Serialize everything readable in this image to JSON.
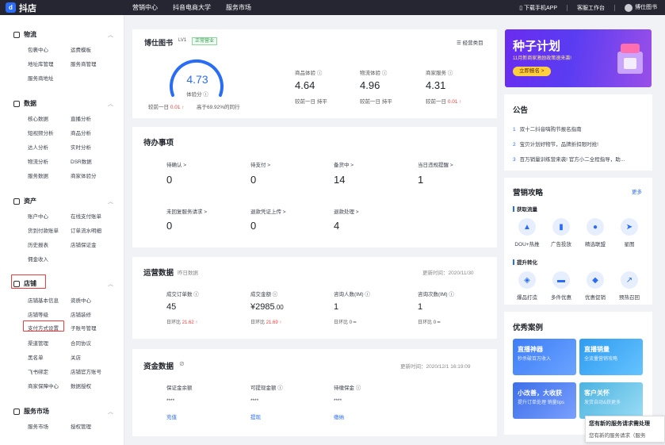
{
  "app": {
    "logo_mark": "d",
    "logo_text": "抖店"
  },
  "topnav": [
    "营销中心",
    "抖音电商大学",
    "服务市场"
  ],
  "topright": {
    "download": "下载手机APP",
    "workbench": "客服工作台",
    "user": "博仕图书"
  },
  "sidebar": {
    "groups": [
      {
        "title": "物流",
        "items": [
          "包裹中心",
          "运费模板",
          "地址库管理",
          "服务商管理",
          "服务商地址"
        ]
      },
      {
        "title": "数据",
        "items": [
          "核心数据",
          "直播分析",
          "短视频分析",
          "商品分析",
          "达人分析",
          "实时分析",
          "物流分析",
          "DSR数据",
          "服务数据",
          "商家体验分"
        ]
      },
      {
        "title": "资产",
        "items": [
          "账户中心",
          "在线支付账单",
          "货到付款账单",
          "订单流水明细",
          "历史报表",
          "店铺保证金",
          "佣金收入"
        ]
      },
      {
        "title": "店铺",
        "items": [
          "店铺基本信息",
          "资质中心",
          "店铺等级",
          "店铺装修",
          "支付方式设置",
          "子账号管理",
          "渠道管理",
          "合同协议",
          "黑名单",
          "关店",
          "飞书绑定",
          "店铺官方账号",
          "商家保障中心",
          "数据授权"
        ]
      },
      {
        "title": "服务市场",
        "items": [
          "服务市场",
          "授权管理"
        ]
      }
    ]
  },
  "shop": {
    "name": "博仕图书",
    "level": "LV1",
    "status": "正常营业",
    "category_link": "经营类目",
    "score": "4.73",
    "score_label": "体验分",
    "compare_prefix": "较前一日",
    "compare_value": "0.01",
    "compare_up": "↑",
    "rank_text": "高于69.92%的同行",
    "metrics": [
      {
        "label": "商品体验",
        "value": "4.64",
        "sub": "较前一日",
        "trend": "持平"
      },
      {
        "label": "物流体验",
        "value": "4.96",
        "sub": "较前一日",
        "trend": "持平"
      },
      {
        "label": "商家服务",
        "value": "4.31",
        "sub": "较前一日",
        "trend": "0.01 ↑"
      }
    ]
  },
  "todo": {
    "title": "待办事项",
    "items": [
      {
        "label": "待确认 >",
        "value": "0"
      },
      {
        "label": "待支付 >",
        "value": "0"
      },
      {
        "label": "备货中 >",
        "value": "14"
      },
      {
        "label": "当日违规提醒 >",
        "value": "1"
      },
      {
        "label": "未回复服务请求 >",
        "value": "0"
      },
      {
        "label": "退款凭证上传 >",
        "value": "0"
      },
      {
        "label": "退款处理 >",
        "value": "4"
      }
    ]
  },
  "ops": {
    "title": "运营数据",
    "sub": "昨日数据",
    "updated": "更新时间：2020/11/30",
    "items": [
      {
        "label": "成交订单数 ⓘ",
        "value": "45",
        "sub": "日环比",
        "delta": "21.62 ↑"
      },
      {
        "label": "成交金额 ⓘ",
        "value": "¥2985",
        "value_dec": ".00",
        "sub": "日环比",
        "delta": "21.69 ↑"
      },
      {
        "label": "咨询人数(IM) ⓘ",
        "value": "1",
        "sub": "日环比",
        "delta": "0 ━"
      },
      {
        "label": "咨询次数(IM) ⓘ",
        "value": "1",
        "sub": "日环比",
        "delta": "0 ━"
      }
    ]
  },
  "funds": {
    "title": "资金数据",
    "updated": "更新时间：2020/12/1 16:19:09",
    "items": [
      {
        "label": "保证金余额",
        "value": "****",
        "link": "充值"
      },
      {
        "label": "可提现金额 ⓘ",
        "value": "****",
        "link": "提现"
      },
      {
        "label": "待缴保金 ⓘ",
        "value": "****",
        "link": "缴纳"
      }
    ]
  },
  "banner": {
    "title": "种子计划",
    "sub": "11月新商家激励政策速来袭!",
    "button": "立即报名 >"
  },
  "notice": {
    "title": "公告",
    "items": [
      {
        "n": "1",
        "text": "双十二抖音嗨购节报名指南"
      },
      {
        "n": "2",
        "text": "宝贝计划好物节，品牌折扣限时抢!"
      },
      {
        "n": "3",
        "text": "百万销量训练营来袭! 官方小二全程指导，助..."
      }
    ]
  },
  "marketing": {
    "title": "营销攻略",
    "more": "更多",
    "sections": [
      {
        "title": "获取流量",
        "tools": [
          "DOU+热推",
          "广告投放",
          "精选联盟",
          "星图"
        ]
      },
      {
        "title": "提升转化",
        "tools": [
          "爆品打造",
          "多件优惠",
          "优惠促销",
          "预热召回"
        ]
      }
    ]
  },
  "cases": {
    "title": "优秀案例",
    "items": [
      {
        "title": "直播神器",
        "sub": "秒杀破百万收入"
      },
      {
        "title": "直播销量",
        "sub": "全流量营销攻略"
      },
      {
        "title": "小改善，大收获",
        "sub": "提升订单处理 销量tips"
      },
      {
        "title": "客户关怀",
        "sub": "发货自动&获更多"
      }
    ]
  },
  "toast": {
    "title": "您有新的服务请求需处理",
    "text": "您有新的服务请求（服务"
  },
  "colors": {
    "brand_blue": "#2a6cf6",
    "alert_red": "#f03c3c",
    "topbar": "#252632"
  }
}
